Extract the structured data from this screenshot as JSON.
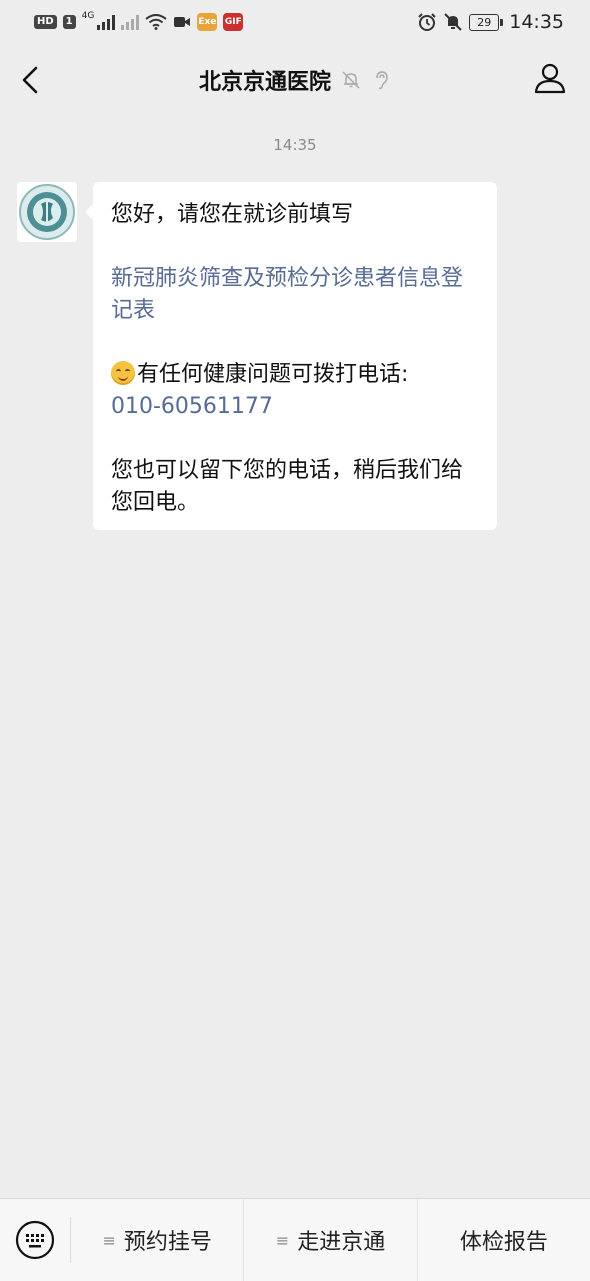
{
  "status_bar": {
    "hd_badge": "HD",
    "sim_badge": "1",
    "network": "4G",
    "app_badge_1": "Exe",
    "app_badge_2": "GIF",
    "battery": "29",
    "time": "14:35"
  },
  "nav": {
    "title": "北京京通医院"
  },
  "chat": {
    "timestamp": "14:35",
    "message": {
      "greeting": "您好，请您在就诊前填写",
      "form_link": "新冠肺炎筛查及预检分诊患者信息登记表",
      "hotline_text": "有任何健康问题可拨打电话:",
      "phone": "010-60561177",
      "callback_text": "您也可以留下您的电话，稍后我们给您回电。"
    }
  },
  "bottom_menu": {
    "items": [
      {
        "label": "预约挂号",
        "has_submenu": true
      },
      {
        "label": "走进京通",
        "has_submenu": true
      },
      {
        "label": "体检报告",
        "has_submenu": false
      }
    ],
    "submenu_glyph": "≡"
  }
}
